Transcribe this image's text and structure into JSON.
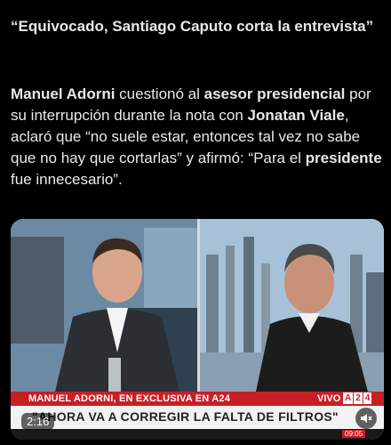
{
  "post": {
    "headline": "“Equivocado, Santiago Caputo corta la entrevista”",
    "body": {
      "p1": "Manuel Adorni",
      "p2": " cuestionó al ",
      "p3": "asesor presidencial",
      "p4": " por su interrupción durante la nota con ",
      "p5": "Jonatan Viale",
      "p6": ", aclaró que “no suele estar, entonces tal vez no sabe que no hay que cortarlas” y afirmó: “Para el ",
      "p7": "presidente",
      "p8": " fue innecesario”."
    }
  },
  "video": {
    "strap_name": "MANUEL ADORNI, EN EXCLUSIVA EN A24",
    "live_label": "VIVO",
    "channel_logo": [
      "A",
      "2",
      "4"
    ],
    "quote": "\"AHORA VA A CORREGIR LA FALTA DE FILTROS\"",
    "timer": "2:16",
    "clock": "09:05",
    "mute_icon": "speaker-muted-icon",
    "colors": {
      "strap_red": "#c81f25",
      "strap_white": "#f2f2f2"
    }
  }
}
